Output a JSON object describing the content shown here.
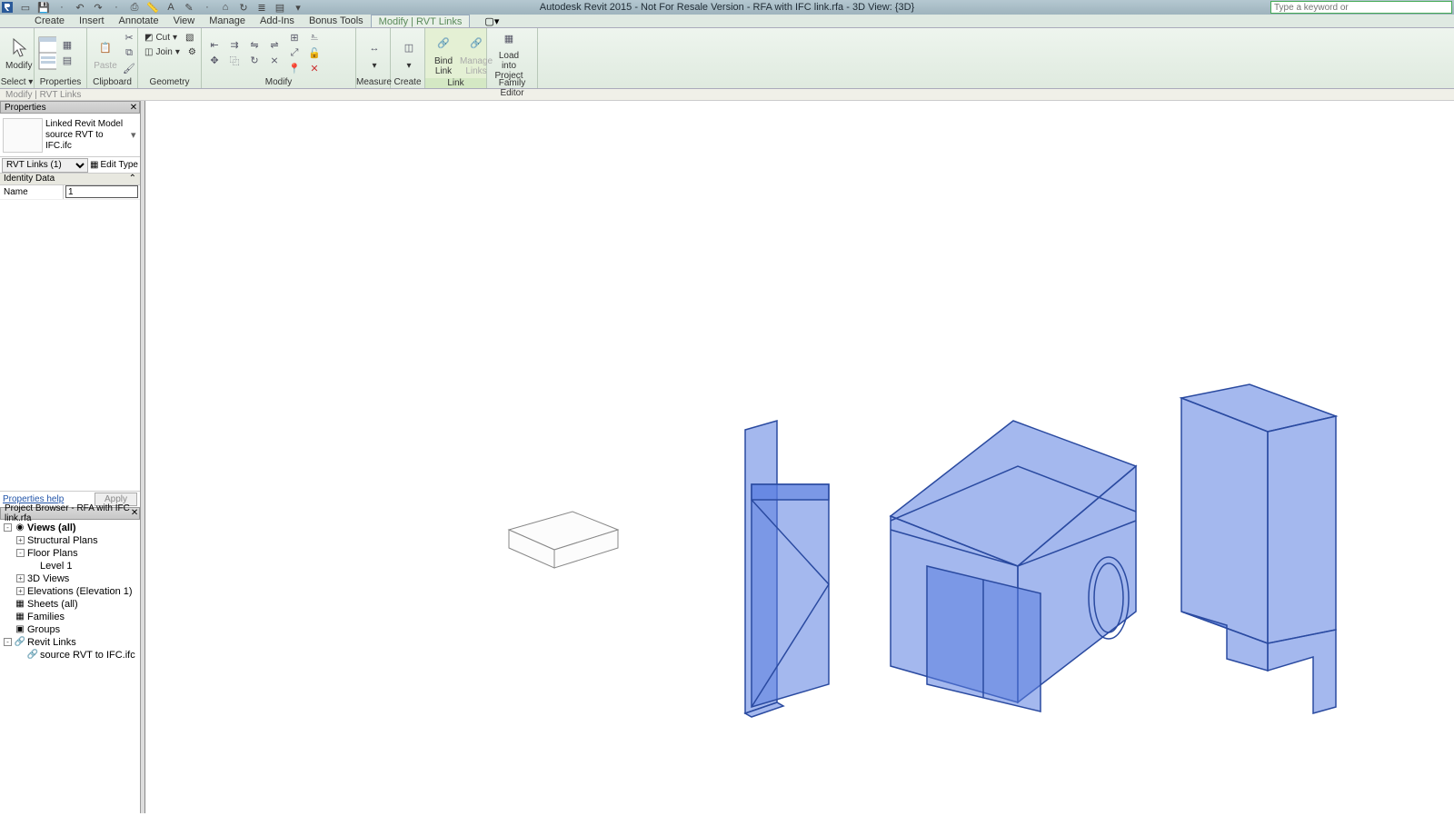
{
  "title": "Autodesk Revit 2015 - Not For Resale Version -     RFA with IFC link.rfa - 3D View: {3D}",
  "search_placeholder": "Type a keyword or",
  "tabs": [
    "Create",
    "Insert",
    "Annotate",
    "View",
    "Manage",
    "Add-Ins",
    "Bonus Tools",
    "Modify | RVT Links"
  ],
  "active_tab": 7,
  "ribbon_groups": {
    "select": "Select ▾",
    "properties": "Properties",
    "clipboard": "Clipboard",
    "geometry": "Geometry",
    "modify": "Modify",
    "measure": "Measure",
    "create": "Create",
    "link": "Link",
    "family_editor": "Family Editor"
  },
  "ribbon_items": {
    "modify": "Modify",
    "paste": "Paste",
    "cut": "Cut",
    "join": "Join",
    "bind_link": "Bind\nLink",
    "manage_links": "Manage\nLinks",
    "load_into_project": "Load into\nProject"
  },
  "context_bar": "Modify | RVT Links",
  "properties_panel": {
    "title": "Properties",
    "type_line1": "Linked Revit Model",
    "type_line2": "source RVT to IFC.ifc",
    "filter_label": "RVT Links (1)",
    "edit_type": "Edit Type",
    "group": "Identity Data",
    "row_name": "Name",
    "name_value": "1",
    "help": "Properties help",
    "apply": "Apply"
  },
  "project_browser": {
    "title": "Project Browser - RFA with IFC link.rfa",
    "nodes": [
      {
        "depth": 0,
        "tw": "-",
        "icon": "◉",
        "label": "Views (all)",
        "bold": true
      },
      {
        "depth": 1,
        "tw": "+",
        "icon": "",
        "label": "Structural Plans"
      },
      {
        "depth": 1,
        "tw": "-",
        "icon": "",
        "label": "Floor Plans"
      },
      {
        "depth": 2,
        "tw": "",
        "icon": "",
        "label": "Level 1"
      },
      {
        "depth": 1,
        "tw": "+",
        "icon": "",
        "label": "3D Views"
      },
      {
        "depth": 1,
        "tw": "+",
        "icon": "",
        "label": "Elevations (Elevation 1)"
      },
      {
        "depth": 0,
        "tw": "",
        "icon": "▦",
        "label": "Sheets (all)"
      },
      {
        "depth": 0,
        "tw": "",
        "icon": "▦",
        "label": "Families"
      },
      {
        "depth": 0,
        "tw": "",
        "icon": "▣",
        "label": "Groups"
      },
      {
        "depth": 0,
        "tw": "-",
        "icon": "🔗",
        "label": "Revit Links"
      },
      {
        "depth": 1,
        "tw": "",
        "icon": "🔗",
        "label": "source RVT to IFC.ifc"
      }
    ]
  }
}
